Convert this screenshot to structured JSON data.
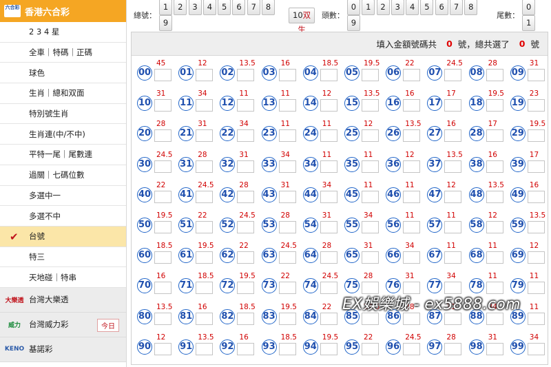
{
  "sidebar": {
    "header_title": "香港六合彩",
    "logo_text": "六合彩",
    "items": [
      {
        "label": "2 3 4 星",
        "active": false
      },
      {
        "label": "全車｜特碼｜正碼",
        "active": false
      },
      {
        "label": "球色",
        "active": false
      },
      {
        "label": "生肖｜總和双面",
        "active": false
      },
      {
        "label": "特別號生肖",
        "active": false
      },
      {
        "label": "生肖連(中/不中)",
        "active": false
      },
      {
        "label": "平特一尾｜尾數連",
        "active": false
      },
      {
        "label": "過關｜七碼位數",
        "active": false
      },
      {
        "label": "多選中一",
        "active": false
      },
      {
        "label": "多選不中",
        "active": false
      },
      {
        "label": "台號",
        "active": true
      },
      {
        "label": "特三",
        "active": false
      },
      {
        "label": "天地碰｜特串",
        "active": false
      }
    ],
    "lotteries": [
      {
        "label": "台灣大樂透",
        "logo": "大樂透",
        "badge": ""
      },
      {
        "label": "台灣威力彩",
        "logo": "威力",
        "badge": "今日"
      },
      {
        "label": "基諾彩",
        "logo": "KENO",
        "badge": ""
      }
    ]
  },
  "topbar": {
    "tens_label": "總號：",
    "tens_keys": [
      "1",
      "2",
      "3",
      "4",
      "5",
      "6",
      "7",
      "8",
      "9"
    ],
    "tens_double_num": "10",
    "tens_double_text": "双生",
    "head_label": "頭數：",
    "head_keys": [
      "0",
      "1",
      "2",
      "3",
      "4",
      "5",
      "6",
      "7",
      "8",
      "9"
    ],
    "tail_label": "尾數：",
    "tail_keys": [
      "0",
      "1"
    ]
  },
  "summary": {
    "text1": "填入金額號碼共",
    "count1": "0",
    "text2": "號，總共選了",
    "count2": "0",
    "text3": "號"
  },
  "numbers": [
    {
      "n": "00",
      "o": "45"
    },
    {
      "n": "01",
      "o": "12"
    },
    {
      "n": "02",
      "o": "13.5"
    },
    {
      "n": "03",
      "o": "16"
    },
    {
      "n": "04",
      "o": "18.5"
    },
    {
      "n": "05",
      "o": "19.5"
    },
    {
      "n": "06",
      "o": "22"
    },
    {
      "n": "07",
      "o": "24.5"
    },
    {
      "n": "08",
      "o": "28"
    },
    {
      "n": "09",
      "o": "31"
    },
    {
      "n": "10",
      "o": "31"
    },
    {
      "n": "11",
      "o": "34"
    },
    {
      "n": "12",
      "o": "11"
    },
    {
      "n": "13",
      "o": "11"
    },
    {
      "n": "14",
      "o": "12"
    },
    {
      "n": "15",
      "o": "13.5"
    },
    {
      "n": "16",
      "o": "16"
    },
    {
      "n": "17",
      "o": "17"
    },
    {
      "n": "18",
      "o": "19.5"
    },
    {
      "n": "19",
      "o": "23"
    },
    {
      "n": "20",
      "o": "28"
    },
    {
      "n": "21",
      "o": "31"
    },
    {
      "n": "22",
      "o": "34"
    },
    {
      "n": "23",
      "o": "11"
    },
    {
      "n": "24",
      "o": "11"
    },
    {
      "n": "25",
      "o": "12"
    },
    {
      "n": "26",
      "o": "13.5"
    },
    {
      "n": "27",
      "o": "16"
    },
    {
      "n": "28",
      "o": "17"
    },
    {
      "n": "29",
      "o": "19.5"
    },
    {
      "n": "30",
      "o": "24.5"
    },
    {
      "n": "31",
      "o": "28"
    },
    {
      "n": "32",
      "o": "31"
    },
    {
      "n": "33",
      "o": "34"
    },
    {
      "n": "34",
      "o": "11"
    },
    {
      "n": "35",
      "o": "11"
    },
    {
      "n": "36",
      "o": "12"
    },
    {
      "n": "37",
      "o": "13.5"
    },
    {
      "n": "38",
      "o": "16"
    },
    {
      "n": "39",
      "o": "17"
    },
    {
      "n": "40",
      "o": "22"
    },
    {
      "n": "41",
      "o": "24.5"
    },
    {
      "n": "42",
      "o": "28"
    },
    {
      "n": "43",
      "o": "31"
    },
    {
      "n": "44",
      "o": "34"
    },
    {
      "n": "45",
      "o": "11"
    },
    {
      "n": "46",
      "o": "11"
    },
    {
      "n": "47",
      "o": "12"
    },
    {
      "n": "48",
      "o": "13.5"
    },
    {
      "n": "49",
      "o": "16"
    },
    {
      "n": "50",
      "o": "19.5"
    },
    {
      "n": "51",
      "o": "22"
    },
    {
      "n": "52",
      "o": "24.5"
    },
    {
      "n": "53",
      "o": "28"
    },
    {
      "n": "54",
      "o": "31"
    },
    {
      "n": "55",
      "o": "34"
    },
    {
      "n": "56",
      "o": "11"
    },
    {
      "n": "57",
      "o": "11"
    },
    {
      "n": "58",
      "o": "12"
    },
    {
      "n": "59",
      "o": "13.5"
    },
    {
      "n": "60",
      "o": "18.5"
    },
    {
      "n": "61",
      "o": "19.5"
    },
    {
      "n": "62",
      "o": "22"
    },
    {
      "n": "63",
      "o": "24.5"
    },
    {
      "n": "64",
      "o": "28"
    },
    {
      "n": "65",
      "o": "31"
    },
    {
      "n": "66",
      "o": "34"
    },
    {
      "n": "67",
      "o": "11"
    },
    {
      "n": "68",
      "o": "11"
    },
    {
      "n": "69",
      "o": "12"
    },
    {
      "n": "70",
      "o": "16"
    },
    {
      "n": "71",
      "o": "18.5"
    },
    {
      "n": "72",
      "o": "19.5"
    },
    {
      "n": "73",
      "o": "22"
    },
    {
      "n": "74",
      "o": "24.5"
    },
    {
      "n": "75",
      "o": "28"
    },
    {
      "n": "76",
      "o": "31"
    },
    {
      "n": "77",
      "o": "34"
    },
    {
      "n": "78",
      "o": "11"
    },
    {
      "n": "79",
      "o": "11"
    },
    {
      "n": "80",
      "o": "13.5"
    },
    {
      "n": "81",
      "o": "16"
    },
    {
      "n": "82",
      "o": "18.5"
    },
    {
      "n": "83",
      "o": "19.5"
    },
    {
      "n": "84",
      "o": "22"
    },
    {
      "n": "85",
      "o": "24.5"
    },
    {
      "n": "86",
      "o": "28"
    },
    {
      "n": "87",
      "o": "31"
    },
    {
      "n": "88",
      "o": "34"
    },
    {
      "n": "89",
      "o": "11"
    },
    {
      "n": "90",
      "o": "12"
    },
    {
      "n": "91",
      "o": "13.5"
    },
    {
      "n": "92",
      "o": "16"
    },
    {
      "n": "93",
      "o": "18.5"
    },
    {
      "n": "94",
      "o": "19.5"
    },
    {
      "n": "95",
      "o": "22"
    },
    {
      "n": "96",
      "o": "24.5"
    },
    {
      "n": "97",
      "o": "28"
    },
    {
      "n": "98",
      "o": "31"
    },
    {
      "n": "99",
      "o": "34"
    }
  ],
  "watermark": "EX娛樂城 - ex5888.com",
  "colors": {
    "accent": "#f5a623",
    "ball": "#1f64c8",
    "odds": "#d10000",
    "active": "#fbe6a8"
  }
}
